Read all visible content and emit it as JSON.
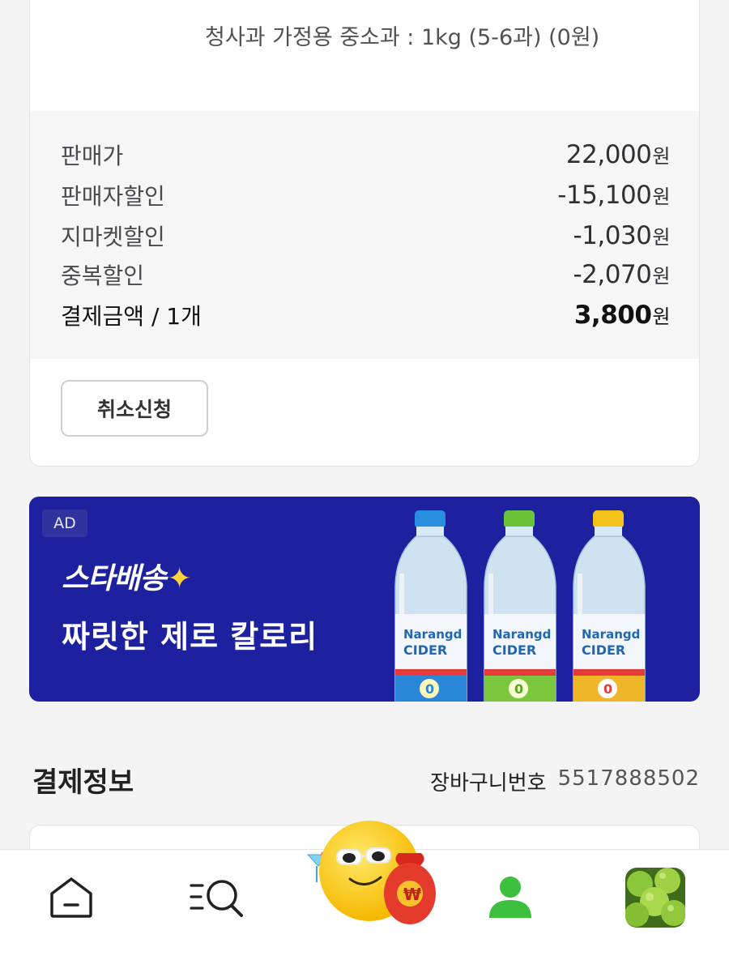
{
  "order": {
    "option_text": "청사과 가정용 중소과 : 1kg (5-6과) (0원)",
    "price_rows": [
      {
        "label": "판매가",
        "amount": "22,000",
        "unit": "원"
      },
      {
        "label": "판매자할인",
        "amount": "-15,100",
        "unit": "원"
      },
      {
        "label": "지마켓할인",
        "amount": "-1,030",
        "unit": "원"
      },
      {
        "label": "중복할인",
        "amount": "-2,070",
        "unit": "원"
      }
    ],
    "total": {
      "label": "결제금액 / 1개",
      "amount": "3,800",
      "unit": "원"
    },
    "cancel_label": "취소신청"
  },
  "ad": {
    "badge": "AD",
    "brand": "스타배송",
    "headline": "짜릿한 제로 칼로리",
    "product_brand": "Narangd",
    "product_name": "CIDER",
    "calorie_badge": "0",
    "colors": {
      "background": "#1d21a0",
      "cap_blue": "#2a8ee0",
      "cap_green": "#6cc23a",
      "cap_yellow": "#f2c21a"
    }
  },
  "payment": {
    "title": "결제정보",
    "cart_label": "장바구니번호",
    "cart_number": "5517888502"
  },
  "nav": {
    "items": [
      "home-icon",
      "category-search-icon",
      "mascot-money-icon",
      "my-page-icon",
      "recent-item-thumbnail"
    ],
    "mascot_currency": "₩",
    "active_color": "#3cbf3c"
  }
}
